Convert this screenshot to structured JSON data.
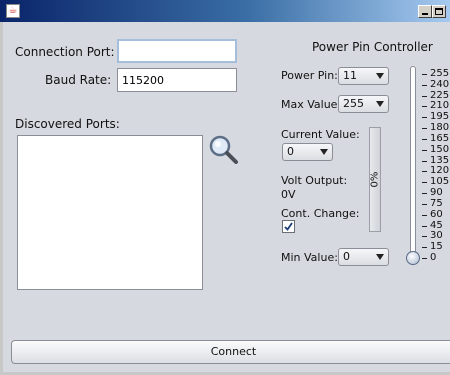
{
  "window": {
    "app_icon": "java-cup-icon"
  },
  "form": {
    "connection_port_label": "Connection Port:",
    "connection_port_value": "",
    "baud_rate_label": "Baud Rate:",
    "baud_rate_value": "115200",
    "discovered_ports_label": "Discovered Ports:",
    "discovered_ports": []
  },
  "controller": {
    "title": "Power Pin Controller",
    "power_pin_label": "Power Pin:",
    "power_pin_value": "11",
    "max_value_label": "Max Value:",
    "max_value_value": "255",
    "current_value_label": "Current Value:",
    "current_value_value": "0",
    "volt_output_label": "Volt Output:",
    "volt_output_value": "0V",
    "cont_change_label": "Cont. Change:",
    "cont_change_checked": true,
    "min_value_label": "Min Value:",
    "min_value_value": "0",
    "progress_text": "0%",
    "progress_fraction": 0,
    "slider_value": 0,
    "slider_min": 0,
    "slider_max": 255,
    "slider_ticks": [
      "255",
      "240",
      "225",
      "210",
      "195",
      "180",
      "165",
      "150",
      "135",
      "120",
      "105",
      "90",
      "75",
      "60",
      "45",
      "30",
      "15",
      "0"
    ]
  },
  "connect_label": "Connect",
  "colors": {
    "title_gradient_start": "#0a246a",
    "title_gradient_end": "#a6caf0",
    "progress_fill": "#6b8bbf"
  }
}
